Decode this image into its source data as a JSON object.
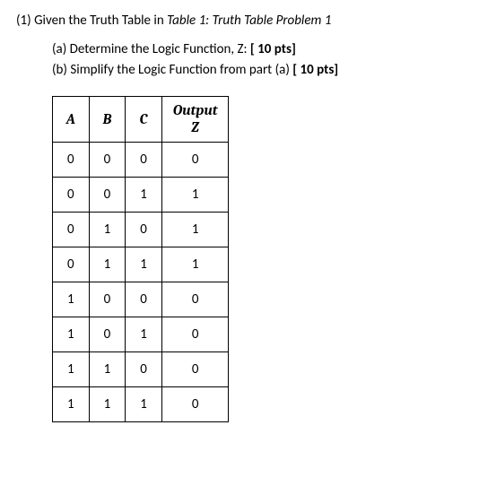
{
  "intro": {
    "label": "(1) Given the Truth Table in ",
    "ref": "Table 1: Truth Table Problem 1"
  },
  "parts": {
    "a": "(a) Determine the Logic Function, Z: ",
    "a_pts": "[ 10 pts]",
    "b": "(b) Simplify the Logic Function from part (a) ",
    "b_pts": "[ 10 pts]"
  },
  "table": {
    "headers": {
      "a": "A",
      "b": "B",
      "c": "C",
      "out": "Output",
      "z": "Z"
    },
    "rows": [
      {
        "a": "0",
        "b": "0",
        "c": "0",
        "z": "0"
      },
      {
        "a": "0",
        "b": "0",
        "c": "1",
        "z": "1"
      },
      {
        "a": "0",
        "b": "1",
        "c": "0",
        "z": "1"
      },
      {
        "a": "0",
        "b": "1",
        "c": "1",
        "z": "1"
      },
      {
        "a": "1",
        "b": "0",
        "c": "0",
        "z": "0"
      },
      {
        "a": "1",
        "b": "0",
        "c": "1",
        "z": "0"
      },
      {
        "a": "1",
        "b": "1",
        "c": "0",
        "z": "0"
      },
      {
        "a": "1",
        "b": "1",
        "c": "1",
        "z": "0"
      }
    ]
  },
  "chart_data": {
    "type": "table",
    "title": "Truth Table Problem 1",
    "columns": [
      "A",
      "B",
      "C",
      "Output Z"
    ],
    "rows": [
      [
        0,
        0,
        0,
        0
      ],
      [
        0,
        0,
        1,
        1
      ],
      [
        0,
        1,
        0,
        1
      ],
      [
        0,
        1,
        1,
        1
      ],
      [
        1,
        0,
        0,
        0
      ],
      [
        1,
        0,
        1,
        0
      ],
      [
        1,
        1,
        0,
        0
      ],
      [
        1,
        1,
        1,
        0
      ]
    ]
  }
}
